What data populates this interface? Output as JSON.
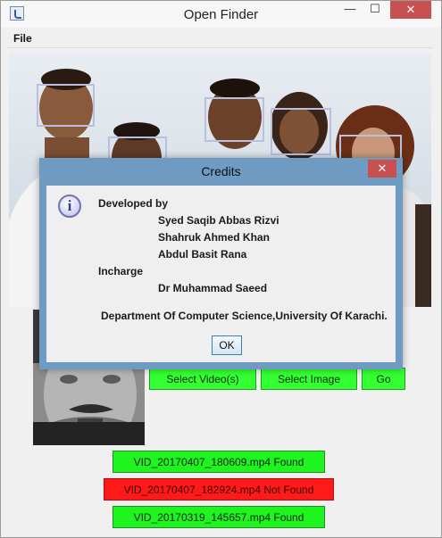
{
  "window": {
    "title": "Open Finder",
    "minimize_glyph": "—",
    "maximize_glyph": "☐",
    "close_glyph": "✕"
  },
  "menubar": {
    "file_label": "File"
  },
  "buttons": {
    "select_videos": "Select Video(s)",
    "select_image": "Select Image",
    "go": "Go"
  },
  "results": [
    {
      "text": "VID_20170407_180609.mp4   Found",
      "status": "found"
    },
    {
      "text": "VID_20170407_182924.mp4   Not Found",
      "status": "not-found"
    },
    {
      "text": "VID_20170319_145657.mp4   Found",
      "status": "found"
    }
  ],
  "dialog": {
    "title": "Credits",
    "close_glyph": "✕",
    "icon_glyph": "i",
    "developed_by_label": "Developed by",
    "developers": [
      "Syed  Saqib Abbas Rizvi",
      "Shahruk Ahmed Khan",
      "Abdul Basit Rana"
    ],
    "incharge_label": "Incharge",
    "incharge_name": "Dr Muhammad Saeed",
    "department": "Department Of Computer Science,University Of Karachi.",
    "ok_label": "OK"
  },
  "colors": {
    "found_green": "#1ef51e",
    "not_found_red": "#ff1a1a",
    "button_green": "#33ff33",
    "dialog_frame": "#6f9ac2",
    "close_red": "#c75050"
  }
}
